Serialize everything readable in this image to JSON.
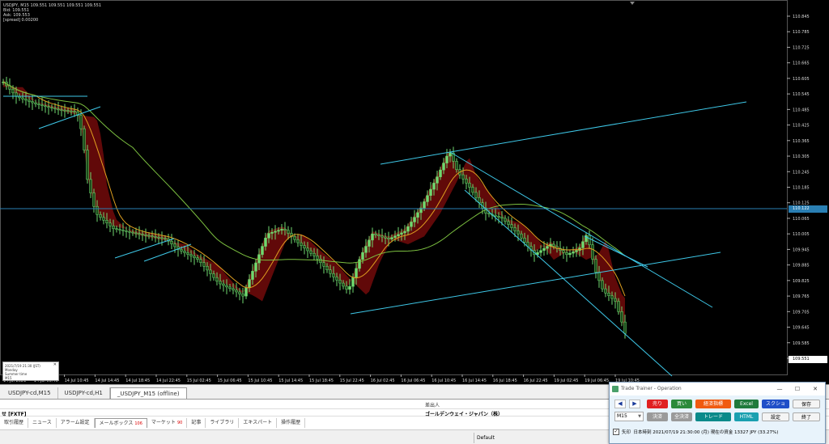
{
  "chart": {
    "symbol_line": "USDJPY, M15  109.551 109.551 109.551 109.551",
    "info_lines": [
      "Bid: 109.551",
      "Ask: 109.553",
      "[spread] 0.00200"
    ],
    "horizontal_price": "110.122",
    "last_price": "109.551",
    "y_ticks": [
      "110.845",
      "110.785",
      "110.725",
      "110.665",
      "110.605",
      "110.545",
      "110.485",
      "110.425",
      "110.365",
      "110.305",
      "110.245",
      "110.185",
      "110.125",
      "110.065",
      "110.005",
      "109.945",
      "109.885",
      "109.825",
      "109.765",
      "109.705",
      "109.645",
      "109.585",
      "109.525"
    ],
    "x_ticks": [
      "14 Jul 2021",
      "14 Jul 06:45",
      "14 Jul 10:45",
      "14 Jul 14:45",
      "14 Jul 18:45",
      "14 Jul 22:45",
      "15 Jul 02:45",
      "15 Jul 06:45",
      "15 Jul 10:45",
      "15 Jul 14:45",
      "15 Jul 18:45",
      "15 Jul 22:45",
      "16 Jul 02:45",
      "16 Jul 06:45",
      "16 Jul 10:45",
      "16 Jul 14:45",
      "16 Jul 18:45",
      "16 Jul 22:45",
      "19 Jul 02:45",
      "19 Jul 06:45",
      "19 Jul 10:45"
    ],
    "mini_panel": [
      "2021/7/19 21:30 (JST)",
      "Monday",
      "Summer time",
      "M15"
    ],
    "colors": {
      "bull": "#6fd86f",
      "bear": "#1c4f1c",
      "cloud_red": "#b01010",
      "ema_orange": "#e0a020",
      "ma_green": "#7cc040",
      "trend": "#3ec8e8",
      "hline": "#2a7fb3",
      "grid": "#3a3a3a"
    }
  },
  "chart_tabs": [
    "USDJPY-cd,M15",
    "USDJPY-cd,H1",
    "_USDJPY_M15 (offline)"
  ],
  "terminal": {
    "header_sender": "差出人",
    "row_left": "せ [FXTF]",
    "row_sender": "ゴールデンウェイ・ジャパン（株）",
    "tabs": [
      {
        "label": "取引履歴",
        "count": ""
      },
      {
        "label": "ニュース",
        "count": ""
      },
      {
        "label": "アラーム設定",
        "count": ""
      },
      {
        "label": "メールボックス",
        "count": "106"
      },
      {
        "label": "マーケット",
        "count": "90"
      },
      {
        "label": "記事",
        "count": ""
      },
      {
        "label": "ライブラリ",
        "count": ""
      },
      {
        "label": "エキスパート",
        "count": ""
      },
      {
        "label": "操作履歴",
        "count": ""
      }
    ],
    "status_default": "Default"
  },
  "trainer": {
    "title": "Trade Trainer - Operation",
    "win_controls": [
      "—",
      "☐",
      "✕"
    ],
    "nav_prev": "◀",
    "nav_next": "▶",
    "btn_sell": "売り",
    "btn_buy": "買い",
    "btn_indicators": "経済指標",
    "btn_excel": "Excel",
    "btn_screenshot": "スクショ",
    "btn_save": "保存",
    "timeframe": "M15",
    "btn_settle": "決済",
    "btn_settle_all": "全決済",
    "btn_trade": "トレード",
    "btn_html": "HTML",
    "btn_settings": "設定",
    "btn_exit": "終了",
    "checkbox_label": "矢印",
    "status_text": "日本時刻 2021/07/19 21:30:00 (月)   現在の資金 13327 JPY (33.27%)"
  }
}
